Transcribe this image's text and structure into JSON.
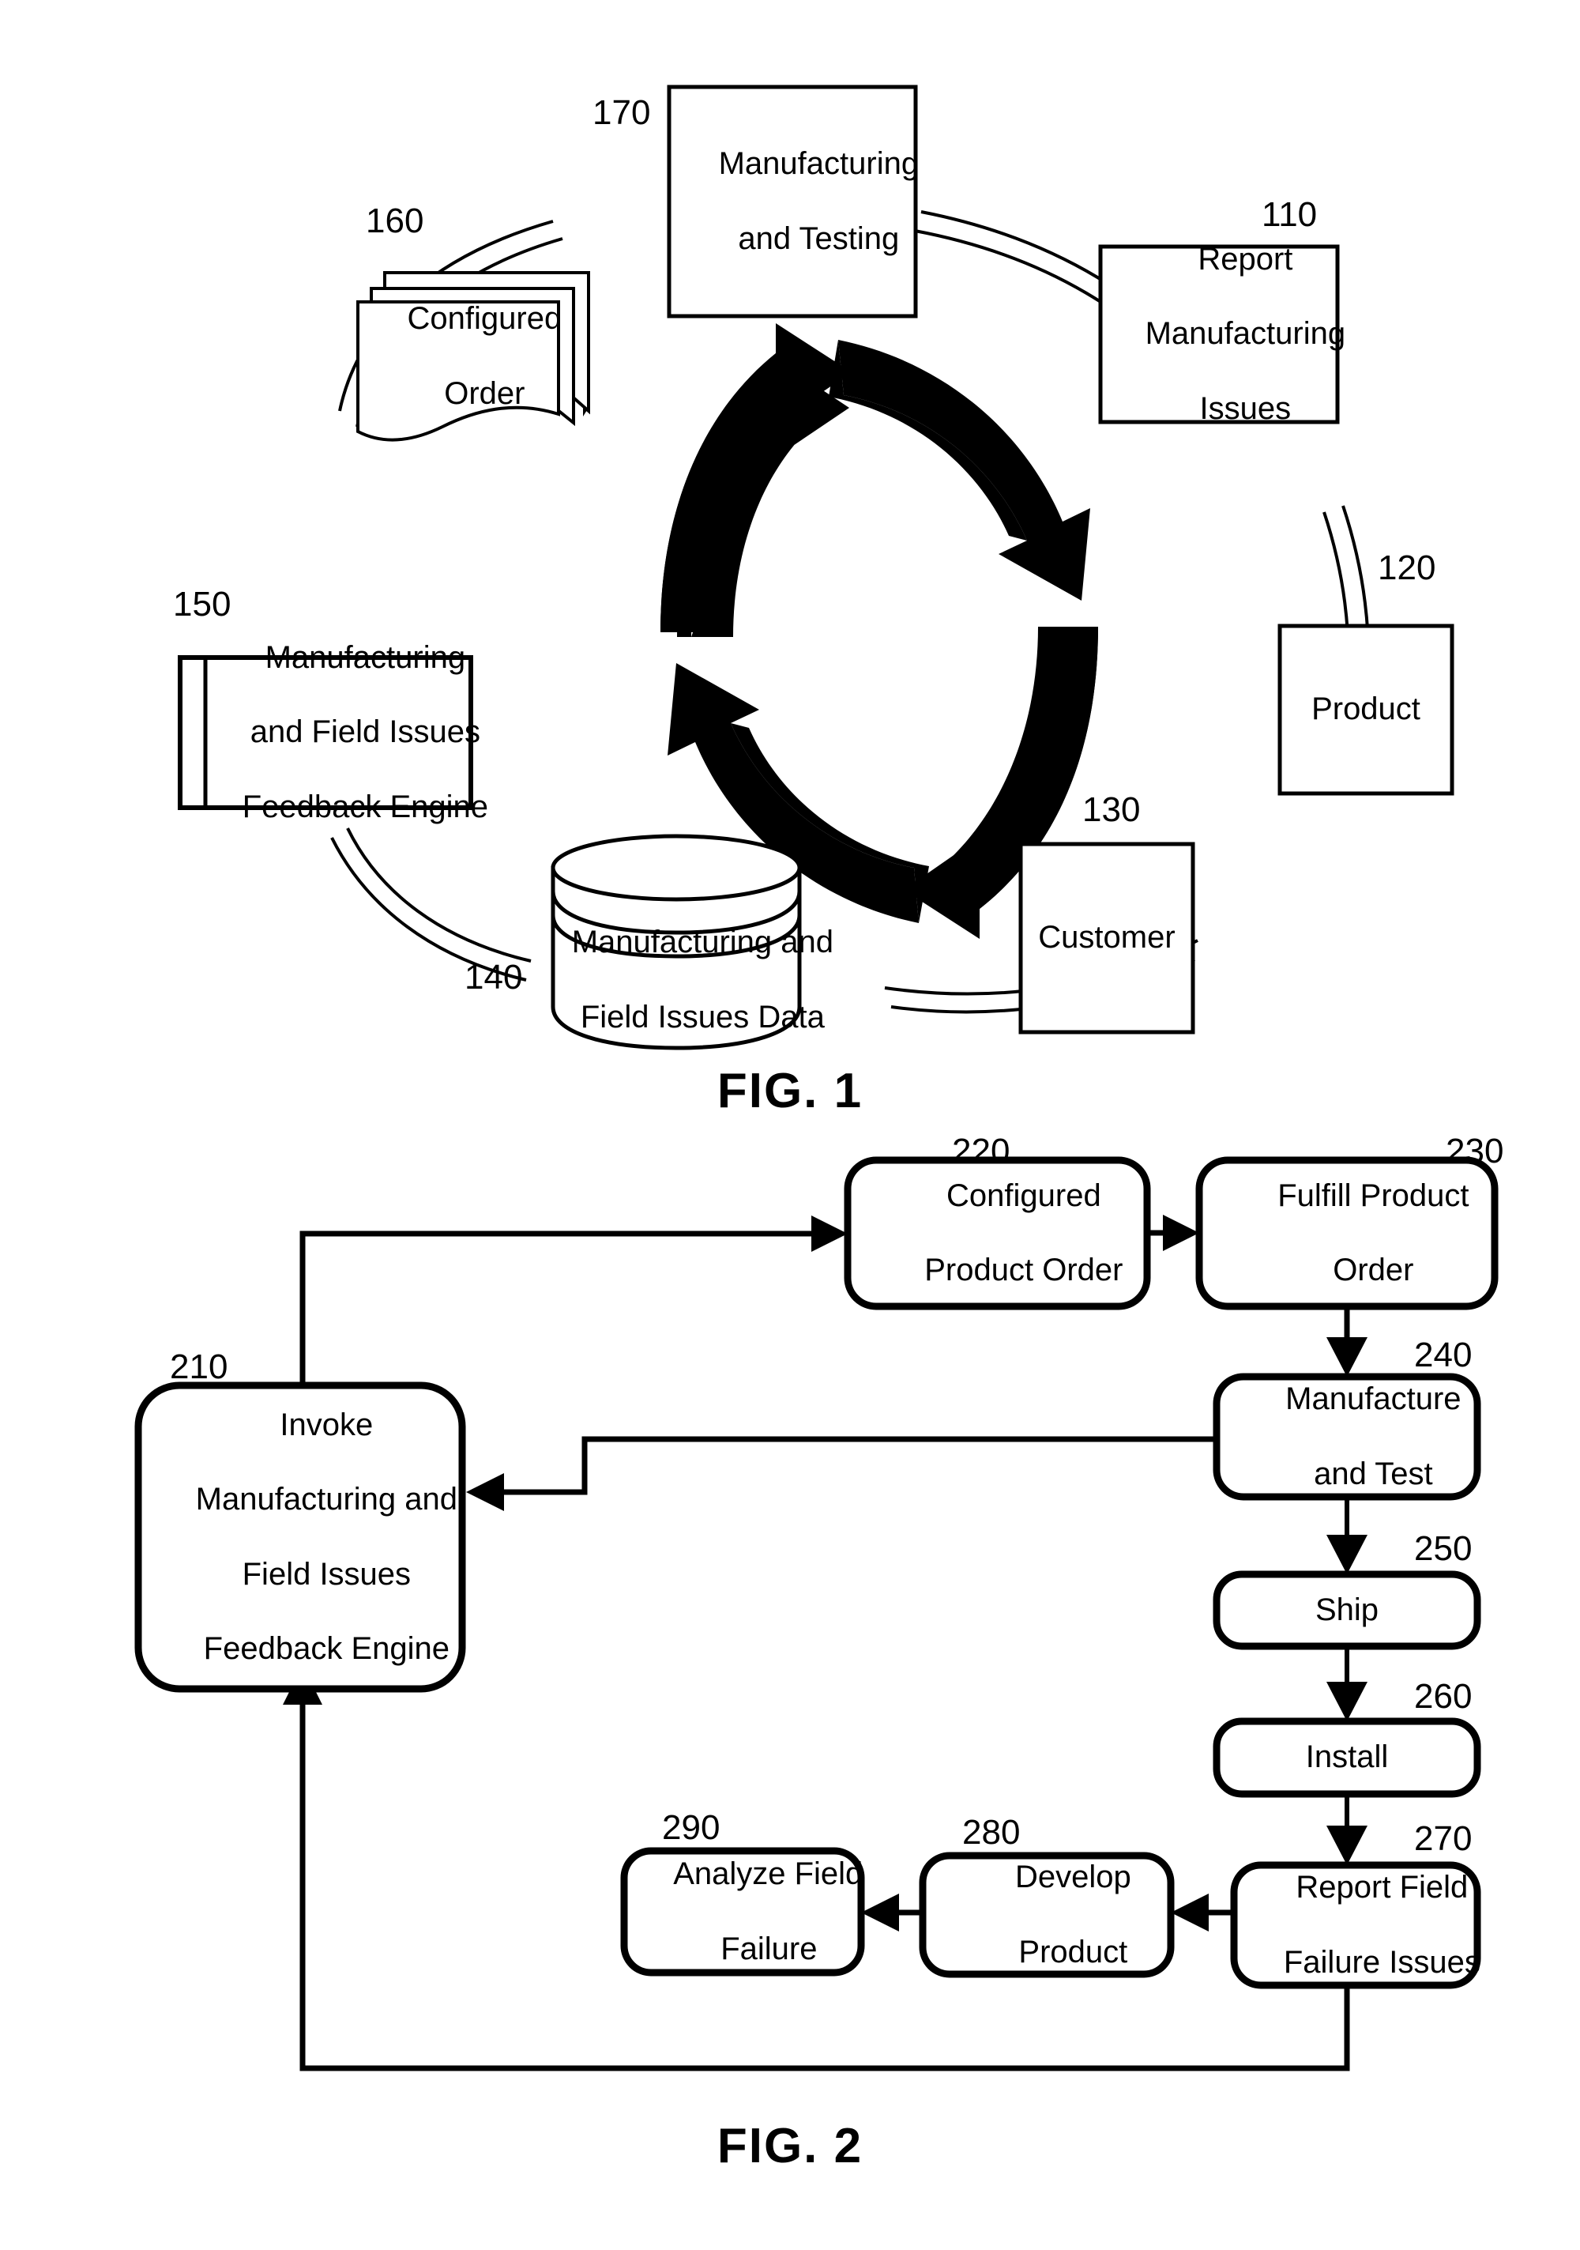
{
  "document": {
    "kind": "patent-figure-sheet",
    "background_color": "#ffffff",
    "line_color": "#000000"
  },
  "figures": [
    {
      "id": "fig1",
      "caption": "FIG. 1",
      "type": "cycle-diagram",
      "center_icon": "recycle-cycle-arrows-icon",
      "nodes": [
        {
          "ref": "170",
          "label": "Manufacturing\nand Testing",
          "shape": "rectangle"
        },
        {
          "ref": "110",
          "label": "Report\nManufacturing\nIssues",
          "shape": "rectangle"
        },
        {
          "ref": "120",
          "label": "Product",
          "shape": "rectangle"
        },
        {
          "ref": "130",
          "label": "Customer",
          "shape": "rectangle"
        },
        {
          "ref": "140",
          "label": "Manufacturing and\nField Issues Data",
          "shape": "database-cylinder"
        },
        {
          "ref": "150",
          "label": "Manufacturing\nand Field Issues\nFeedback Engine",
          "shape": "predefined-process"
        },
        {
          "ref": "160",
          "label": "Configured\nOrder",
          "shape": "multi-document"
        }
      ]
    },
    {
      "id": "fig2",
      "caption": "FIG. 2",
      "type": "flowchart",
      "nodes": [
        {
          "ref": "210",
          "label": "Invoke\nManufacturing and\nField Issues\nFeedback Engine",
          "shape": "rounded-rectangle"
        },
        {
          "ref": "220",
          "label": "Configured\nProduct Order",
          "shape": "rounded-rectangle"
        },
        {
          "ref": "230",
          "label": "Fulfill Product\nOrder",
          "shape": "rounded-rectangle"
        },
        {
          "ref": "240",
          "label": "Manufacture\nand Test",
          "shape": "rounded-rectangle"
        },
        {
          "ref": "250",
          "label": "Ship",
          "shape": "rounded-rectangle"
        },
        {
          "ref": "260",
          "label": "Install",
          "shape": "rounded-rectangle"
        },
        {
          "ref": "270",
          "label": "Report Field\nFailure Issues",
          "shape": "rounded-rectangle"
        },
        {
          "ref": "280",
          "label": "Develop\nProduct",
          "shape": "rounded-rectangle"
        },
        {
          "ref": "290",
          "label": "Analyze Field\nFailure",
          "shape": "rounded-rectangle"
        }
      ],
      "edges": [
        {
          "from": "210",
          "to": "220",
          "style": "orthogonal-arrow"
        },
        {
          "from": "220",
          "to": "230",
          "style": "straight-arrow"
        },
        {
          "from": "230",
          "to": "240",
          "style": "straight-arrow"
        },
        {
          "from": "240",
          "to": "210",
          "style": "orthogonal-arrow"
        },
        {
          "from": "240",
          "to": "250",
          "style": "straight-arrow"
        },
        {
          "from": "250",
          "to": "260",
          "style": "straight-arrow"
        },
        {
          "from": "260",
          "to": "270",
          "style": "straight-arrow"
        },
        {
          "from": "270",
          "to": "280",
          "style": "straight-arrow"
        },
        {
          "from": "280",
          "to": "290",
          "style": "straight-arrow"
        },
        {
          "from": "270",
          "to": "210",
          "style": "orthogonal-arrow"
        }
      ]
    }
  ],
  "fig1": {
    "caption": "FIG. 1",
    "n170": {
      "ref": "170",
      "l1": "Manufacturing",
      "l2": "and Testing"
    },
    "n110": {
      "ref": "110",
      "l1": "Report",
      "l2": "Manufacturing",
      "l3": "Issues"
    },
    "n120": {
      "ref": "120",
      "l1": "Product"
    },
    "n130": {
      "ref": "130",
      "l1": "Customer"
    },
    "n140": {
      "ref": "140",
      "l1": "Manufacturing and",
      "l2": "Field Issues Data"
    },
    "n150": {
      "ref": "150",
      "l1": "Manufacturing",
      "l2": "and Field Issues",
      "l3": "Feedback Engine"
    },
    "n160": {
      "ref": "160",
      "l1": "Configured",
      "l2": "Order"
    }
  },
  "fig2": {
    "caption": "FIG. 2",
    "n210": {
      "ref": "210",
      "l1": "Invoke",
      "l2": "Manufacturing and",
      "l3": "Field Issues",
      "l4": "Feedback Engine"
    },
    "n220": {
      "ref": "220",
      "l1": "Configured",
      "l2": "Product Order"
    },
    "n230": {
      "ref": "230",
      "l1": "Fulfill Product",
      "l2": "Order"
    },
    "n240": {
      "ref": "240",
      "l1": "Manufacture",
      "l2": "and Test"
    },
    "n250": {
      "ref": "250",
      "l1": "Ship"
    },
    "n260": {
      "ref": "260",
      "l1": "Install"
    },
    "n270": {
      "ref": "270",
      "l1": "Report Field",
      "l2": "Failure Issues"
    },
    "n280": {
      "ref": "280",
      "l1": "Develop",
      "l2": "Product"
    },
    "n290": {
      "ref": "290",
      "l1": "Analyze Field",
      "l2": "Failure"
    }
  }
}
